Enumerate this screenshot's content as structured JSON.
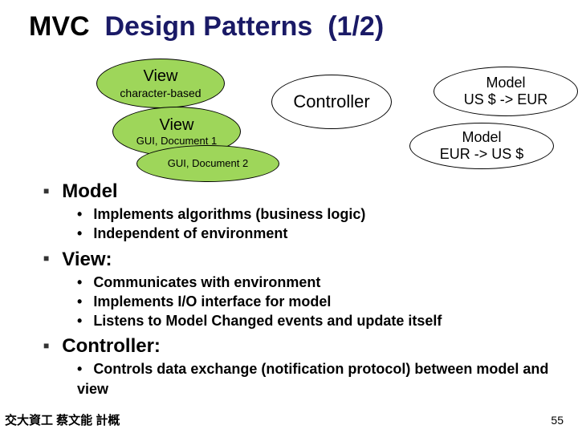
{
  "title": {
    "mvc": "MVC",
    "dp": "Design Patterns",
    "page": "(1/2)"
  },
  "diagram": {
    "view1": {
      "label": "View",
      "sub": "character-based"
    },
    "view2": {
      "label": "View",
      "sub": "GUI, Document 1"
    },
    "view3": {
      "sub": "GUI, Document 2"
    },
    "controller": "Controller",
    "model1": {
      "l1": "Model",
      "l2": "US $  ->  EUR"
    },
    "model2": {
      "l1": "Model",
      "l2": "EUR -> US $"
    }
  },
  "sections": {
    "model": {
      "heading": "Model",
      "items": [
        "Implements algorithms (business logic)",
        "Independent of environment"
      ]
    },
    "view": {
      "heading": "View:",
      "items": [
        "Communicates with environment",
        "Implements I/O interface for model",
        "Listens to Model Changed events and update itself"
      ]
    },
    "controller": {
      "heading": "Controller:",
      "items": [
        "Controls data exchange (notification protocol) between model and view"
      ]
    }
  },
  "footer": {
    "left": "交大資工 蔡文能 計概",
    "right": "55"
  }
}
